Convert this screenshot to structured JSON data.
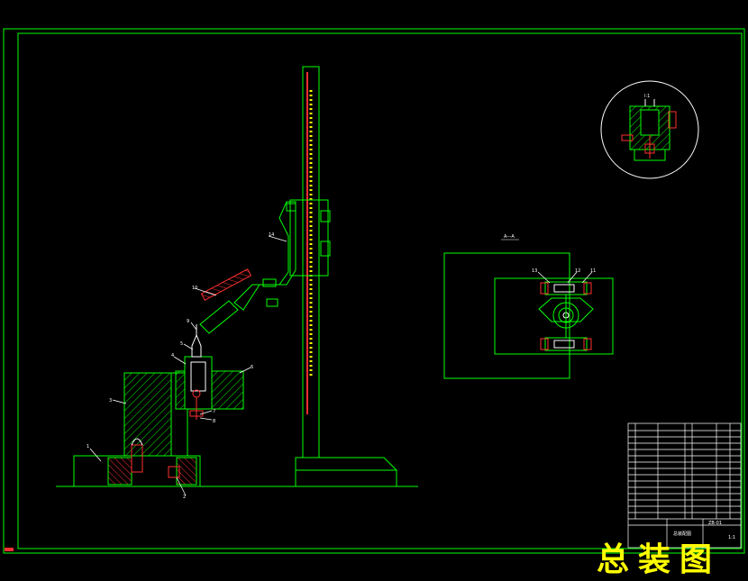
{
  "sheet": {
    "title": "总装图",
    "section_label": "A—A",
    "detail_label": "I:1",
    "table_title": "总装配图",
    "drawing_no": "ZB-01",
    "scale": "1:1"
  },
  "parts_labels": [
    "1",
    "2",
    "3",
    "4",
    "5",
    "6",
    "7",
    "8",
    "9",
    "10",
    "11",
    "12",
    "13",
    "14",
    "15"
  ],
  "colors": {
    "background": "#000000",
    "line": "#00ff00",
    "accent": "#ff0000",
    "hatch": "#00ff00",
    "text": "#ffffff",
    "title": "#ffff00"
  }
}
